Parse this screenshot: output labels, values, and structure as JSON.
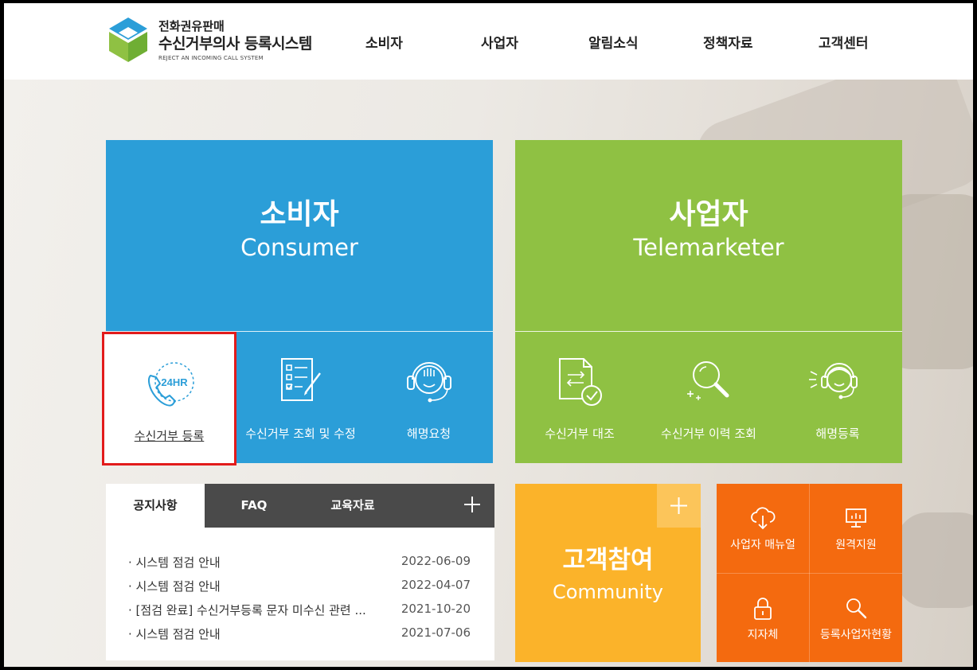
{
  "header": {
    "logo_line1": "전화권유판매",
    "logo_line2": "수신거부의사 등록시스템",
    "logo_line3": "REJECT AN INCOMING CALL SYSTEM",
    "nav": [
      "소비자",
      "사업자",
      "알림소식",
      "정책자료",
      "고객센터"
    ]
  },
  "consumer": {
    "title_ko": "소비자",
    "title_en": "Consumer",
    "menu": [
      {
        "label": "수신거부 등록",
        "icon": "phone-24hr-icon"
      },
      {
        "label": "수신거부 조회 및 수정",
        "icon": "checklist-icon"
      },
      {
        "label": "해명요청",
        "icon": "headset-agent-icon"
      }
    ]
  },
  "business": {
    "title_ko": "사업자",
    "title_en": "Telemarketer",
    "menu": [
      {
        "label": "수신거부 대조",
        "icon": "document-compare-icon"
      },
      {
        "label": "수신거부 이력 조회",
        "icon": "magnifier-icon"
      },
      {
        "label": "해명등록",
        "icon": "headset-agent-icon"
      }
    ]
  },
  "board": {
    "tabs": [
      "공지사항",
      "FAQ",
      "교육자료"
    ],
    "active_tab": "공지사항",
    "notices": [
      {
        "title": "· 시스템 점검 안내",
        "date": "2022-06-09"
      },
      {
        "title": "· 시스템 점검 안내",
        "date": "2022-04-07"
      },
      {
        "title": "· [점검 완료] 수신거부등록 문자 미수신 관련 ...",
        "date": "2021-10-20"
      },
      {
        "title": "· 시스템 점검 안내",
        "date": "2021-07-06"
      }
    ]
  },
  "community": {
    "title_ko": "고객참여",
    "title_en": "Community"
  },
  "quick_links": [
    {
      "label": "사업자 매뉴얼",
      "icon": "cloud-download-icon"
    },
    {
      "label": "원격지원",
      "icon": "monitor-icon"
    },
    {
      "label": "지자체",
      "icon": "lock-icon"
    },
    {
      "label": "등록사업자현황",
      "icon": "search-icon"
    }
  ],
  "colors": {
    "consumer": "#2b9ed8",
    "business": "#8fc143",
    "community": "#fbb32a",
    "quick": "#f46a0f",
    "highlight_border": "#e21b1b"
  }
}
